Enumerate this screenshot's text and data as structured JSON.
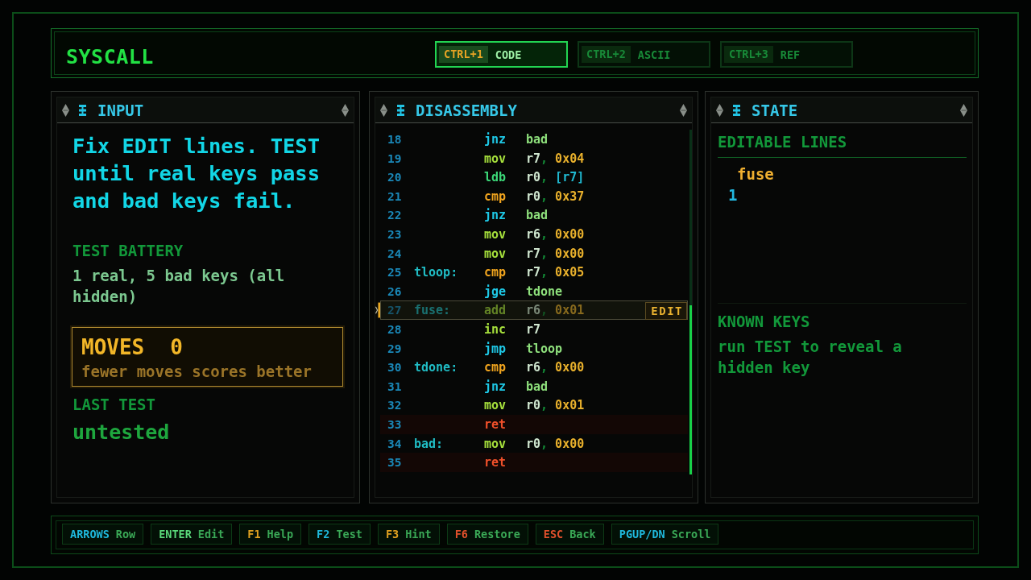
{
  "header": {
    "title": "SYSCALL",
    "tabs": [
      {
        "key": "CTRL+1",
        "label": "CODE",
        "selected": true
      },
      {
        "key": "CTRL+2",
        "label": "ASCII",
        "selected": false
      },
      {
        "key": "CTRL+3",
        "label": "REF",
        "selected": false
      }
    ]
  },
  "input_panel": {
    "title": "INPUT",
    "instructions": "Fix EDIT lines. TEST until real keys pass and bad keys fail.",
    "battery": {
      "heading": "TEST BATTERY",
      "text": "1 real, 5 bad keys (all hidden)"
    },
    "moves": {
      "label": "MOVES",
      "value": "0",
      "note": "fewer moves scores better"
    },
    "last_test": {
      "heading": "LAST TEST",
      "value": "untested"
    }
  },
  "disassembly_panel": {
    "title": "DISASSEMBLY",
    "lines": [
      {
        "line": "18",
        "op": {
          "text": "jnz",
          "kind": "branch"
        },
        "args": [
          {
            "text": "bad",
            "kind": "label"
          }
        ],
        "selected": false
      },
      {
        "line": "19",
        "op": {
          "text": "mov",
          "kind": "arith"
        },
        "args": [
          {
            "text": "r7",
            "kind": "reg"
          },
          {
            "text": ",",
            "kind": "sep"
          },
          {
            "text": "0x04",
            "kind": "imm"
          }
        ],
        "selected": false
      },
      {
        "line": "20",
        "op": {
          "text": "ldb",
          "kind": "load"
        },
        "args": [
          {
            "text": "r0",
            "kind": "reg"
          },
          {
            "text": ",",
            "kind": "sep"
          },
          {
            "text": "[r7]",
            "kind": "mem"
          }
        ],
        "selected": false
      },
      {
        "line": "21",
        "op": {
          "text": "cmp",
          "kind": "compare"
        },
        "args": [
          {
            "text": "r0",
            "kind": "reg"
          },
          {
            "text": ",",
            "kind": "sep"
          },
          {
            "text": "0x37",
            "kind": "imm"
          }
        ],
        "selected": false
      },
      {
        "line": "22",
        "op": {
          "text": "jnz",
          "kind": "branch"
        },
        "args": [
          {
            "text": "bad",
            "kind": "label"
          }
        ],
        "selected": false
      },
      {
        "line": "23",
        "op": {
          "text": "mov",
          "kind": "arith"
        },
        "args": [
          {
            "text": "r6",
            "kind": "reg"
          },
          {
            "text": ",",
            "kind": "sep"
          },
          {
            "text": "0x00",
            "kind": "imm"
          }
        ],
        "selected": false
      },
      {
        "line": "24",
        "op": {
          "text": "mov",
          "kind": "arith"
        },
        "args": [
          {
            "text": "r7",
            "kind": "reg"
          },
          {
            "text": ",",
            "kind": "sep"
          },
          {
            "text": "0x00",
            "kind": "imm"
          }
        ],
        "selected": false
      },
      {
        "line": "25",
        "label": "tloop:",
        "op": {
          "text": "cmp",
          "kind": "compare"
        },
        "args": [
          {
            "text": "r7",
            "kind": "reg"
          },
          {
            "text": ",",
            "kind": "sep"
          },
          {
            "text": "0x05",
            "kind": "imm"
          }
        ],
        "selected": false
      },
      {
        "line": "26",
        "op": {
          "text": "jge",
          "kind": "branch"
        },
        "args": [
          {
            "text": "tdone",
            "kind": "label"
          }
        ],
        "selected": false
      },
      {
        "line": "27",
        "label": "fuse:",
        "op": {
          "text": "add",
          "kind": "arith"
        },
        "args": [
          {
            "text": "r6",
            "kind": "reg"
          },
          {
            "text": ",",
            "kind": "sep"
          },
          {
            "text": "0x01",
            "kind": "imm"
          }
        ],
        "badge": "EDIT",
        "selected": true
      },
      {
        "line": "28",
        "op": {
          "text": "inc",
          "kind": "arith"
        },
        "args": [
          {
            "text": "r7",
            "kind": "reg"
          }
        ],
        "selected": false
      },
      {
        "line": "29",
        "op": {
          "text": "jmp",
          "kind": "branch"
        },
        "args": [
          {
            "text": "tloop",
            "kind": "label"
          }
        ],
        "selected": false
      },
      {
        "line": "30",
        "label": "tdone:",
        "op": {
          "text": "cmp",
          "kind": "compare"
        },
        "args": [
          {
            "text": "r6",
            "kind": "reg"
          },
          {
            "text": ",",
            "kind": "sep"
          },
          {
            "text": "0x00",
            "kind": "imm"
          }
        ],
        "selected": false
      },
      {
        "line": "31",
        "op": {
          "text": "jnz",
          "kind": "branch"
        },
        "args": [
          {
            "text": "bad",
            "kind": "label"
          }
        ],
        "selected": false
      },
      {
        "line": "32",
        "op": {
          "text": "mov",
          "kind": "arith"
        },
        "args": [
          {
            "text": "r0",
            "kind": "reg"
          },
          {
            "text": ",",
            "kind": "sep"
          },
          {
            "text": "0x01",
            "kind": "imm"
          }
        ],
        "selected": false
      },
      {
        "line": "33",
        "op": {
          "text": "ret",
          "kind": "return"
        },
        "selected": false
      },
      {
        "line": "34",
        "label": "bad:",
        "op": {
          "text": "mov",
          "kind": "arith"
        },
        "args": [
          {
            "text": "r0",
            "kind": "reg"
          },
          {
            "text": ",",
            "kind": "sep"
          },
          {
            "text": "0x00",
            "kind": "imm"
          }
        ],
        "selected": false
      },
      {
        "line": "35",
        "op": {
          "text": "ret",
          "kind": "return"
        },
        "selected": false
      }
    ]
  },
  "state_panel": {
    "title": "STATE",
    "editable_lines": {
      "heading": "EDITABLE LINES",
      "entries": [
        {
          "label": "fuse",
          "count": "1"
        }
      ]
    },
    "known_keys": {
      "heading": "KNOWN KEYS",
      "text": "run TEST to reveal a hidden key"
    }
  },
  "footer": {
    "hints": [
      {
        "key": "ARROWS",
        "action": "Row",
        "color": "#1fb8dc"
      },
      {
        "key": "ENTER",
        "action": "Edit",
        "color": "#5ad87a"
      },
      {
        "key": "F1",
        "action": "Help",
        "color": "#e0a020"
      },
      {
        "key": "F2",
        "action": "Test",
        "color": "#1fb8dc"
      },
      {
        "key": "F3",
        "action": "Hint",
        "color": "#e0a020"
      },
      {
        "key": "F6",
        "action": "Restore",
        "color": "#e0502c"
      },
      {
        "key": "ESC",
        "action": "Back",
        "color": "#e0502c"
      },
      {
        "key": "PGUP/DN",
        "action": "Scroll",
        "color": "#1fb8dc"
      }
    ]
  }
}
